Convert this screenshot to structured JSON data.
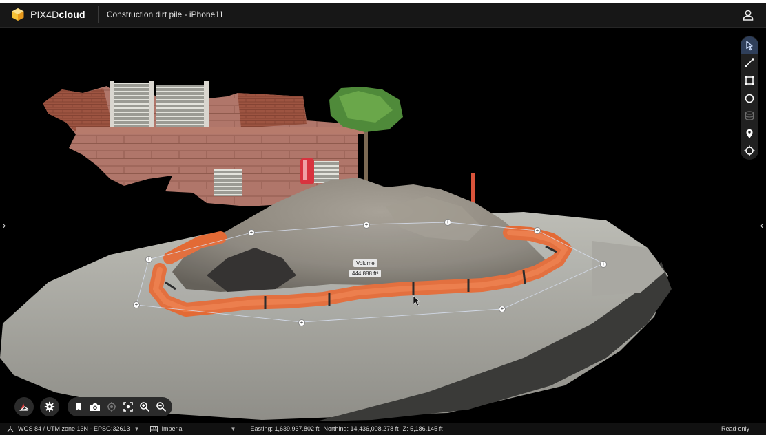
{
  "header": {
    "brand_prefix": "PIX4D",
    "brand_suffix": "cloud",
    "project_title": "Construction dirt pile - iPhone11"
  },
  "measurement": {
    "name": "Volume",
    "value": "444.888 ft³"
  },
  "toolbar": {
    "tools": [
      {
        "icon": "select-icon",
        "active": true
      },
      {
        "icon": "polyline-icon"
      },
      {
        "icon": "polygon-icon"
      },
      {
        "icon": "circle-icon"
      },
      {
        "icon": "volume-icon",
        "disabled": true
      },
      {
        "icon": "marker-icon"
      },
      {
        "icon": "crosshair-icon"
      }
    ]
  },
  "status": {
    "crs": "WGS 84 / UTM zone 13N - EPSG:32613",
    "units": "Imperial",
    "easting": "Easting: 1,639,937.802 ft",
    "northing": "Northing: 14,436,008.278 ft",
    "z": "Z: 5,186.145 ft",
    "mode": "Read-only"
  },
  "colors": {
    "accent": "#2f3f5a",
    "sock_orange": "#e36a35",
    "background": "#000000"
  }
}
